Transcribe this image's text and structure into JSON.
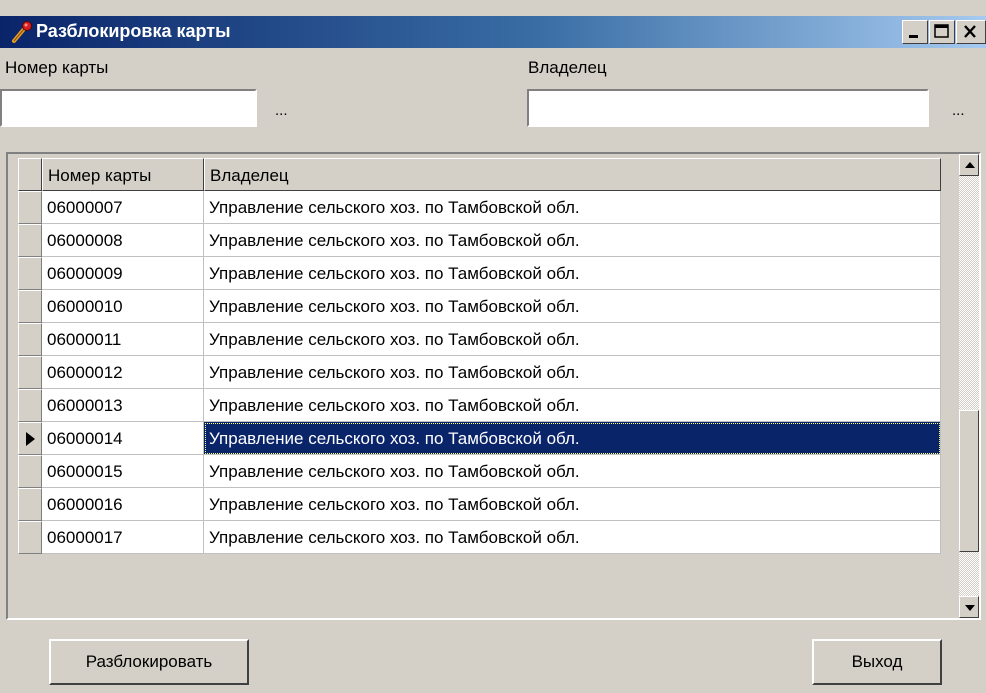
{
  "window": {
    "title": "Разблокировка карты",
    "icon": "key-icon",
    "controls": [
      "_",
      "□",
      "×"
    ]
  },
  "filters": {
    "card_number": {
      "label": "Номер карты",
      "value": "",
      "ellipsis": "..."
    },
    "owner": {
      "label": "Владелец",
      "value": "",
      "ellipsis": "..."
    }
  },
  "table": {
    "columns": [
      "Номер карты",
      "Владелец"
    ],
    "selected_row": 7,
    "rows": [
      [
        "06000007",
        "Управление сельского хоз. по Тамбовской обл."
      ],
      [
        "06000008",
        "Управление сельского хоз. по Тамбовской обл."
      ],
      [
        "06000009",
        "Управление сельского хоз. по Тамбовской обл."
      ],
      [
        "06000010",
        "Управление сельского хоз. по Тамбовской обл."
      ],
      [
        "06000011",
        "Управление сельского хоз. по Тамбовской обл."
      ],
      [
        "06000012",
        "Управление сельского хоз. по Тамбовской обл."
      ],
      [
        "06000013",
        "Управление сельского хоз. по Тамбовской обл."
      ],
      [
        "06000014",
        "Управление сельского хоз. по Тамбовской обл."
      ],
      [
        "06000015",
        "Управление сельского хоз. по Тамбовской обл."
      ],
      [
        "06000016",
        "Управление сельского хоз. по Тамбовской обл."
      ],
      [
        "06000017",
        "Управление сельского хоз. по Тамбовской обл."
      ]
    ]
  },
  "buttons": {
    "unlock": "Разблокировать",
    "exit": "Выход"
  },
  "colors": {
    "titlebar_start": "#0a246a",
    "titlebar_end": "#a6caf0",
    "selection": "#0a246a",
    "face": "#d4d0c8"
  }
}
